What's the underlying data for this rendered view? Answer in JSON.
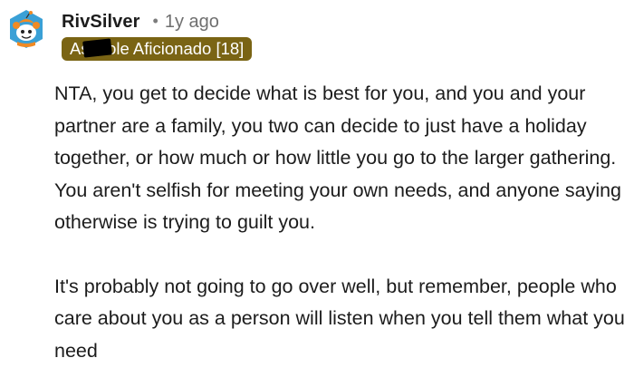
{
  "comment": {
    "author": "RivSilver",
    "separator": "•",
    "time_ago": "1y ago",
    "flair": "Asshole Aficionado [18]",
    "paragraphs": [
      "NTA, you get to decide what is best for you, and you and your partner are a family, you two can decide to just have a holiday together, or how much or how little you go to the larger gathering. You aren't selfish for meeting your own needs, and anyone saying otherwise is trying to guilt you.",
      "It's probably not going to go over well, but remember, people who care about you as a person will listen when you tell them what you need"
    ]
  },
  "colors": {
    "flair_bg": "#7a6414",
    "flair_text": "#ffffff",
    "text": "#1c1c1c",
    "muted": "#6f6f6f"
  },
  "icons": {
    "avatar": "snoo-avatar-icon"
  }
}
